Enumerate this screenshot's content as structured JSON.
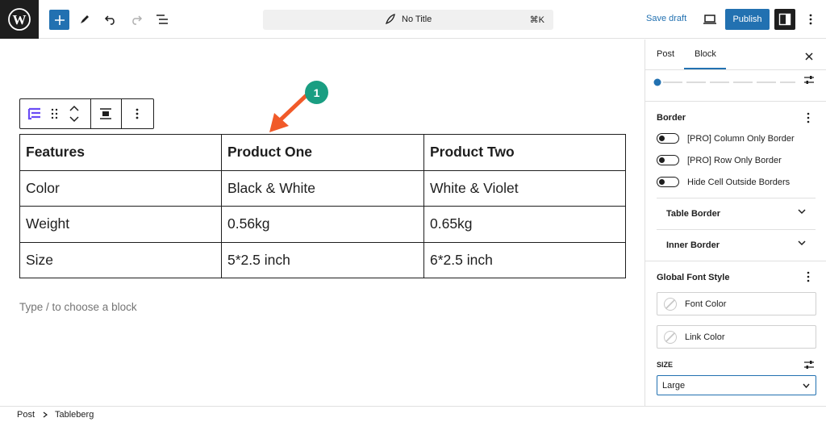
{
  "topbar": {
    "document_title": "No Title",
    "shortcut": "⌘K",
    "save_draft": "Save draft",
    "publish": "Publish",
    "accent_color": "#2271b1"
  },
  "annotation": {
    "badge": "1",
    "color": "#1a9e82",
    "arrow_color": "#f15a29"
  },
  "table": {
    "rows": [
      [
        "Features",
        "Product One",
        "Product Two"
      ],
      [
        "Color",
        "Black & White",
        "White & Violet"
      ],
      [
        "Weight",
        "0.56kg",
        "0.65kg"
      ],
      [
        "Size",
        "5*2.5 inch",
        "6*2.5 inch"
      ]
    ]
  },
  "canvas": {
    "placeholder": "Type / to choose a block"
  },
  "sidebar": {
    "tabs": [
      "Post",
      "Block"
    ],
    "active_tab": "Block",
    "border_section": {
      "title": "Border",
      "toggles": [
        "[PRO] Column Only Border",
        "[PRO] Row Only Border",
        "Hide Cell Outside Borders"
      ],
      "panels": [
        "Table Border",
        "Inner Border"
      ]
    },
    "font_section": {
      "title": "Global Font Style",
      "colors": [
        "Font Color",
        "Link Color"
      ],
      "size_label": "SIZE",
      "size_value": "Large"
    }
  },
  "footer": {
    "breadcrumb": [
      "Post",
      "Tableberg"
    ]
  }
}
